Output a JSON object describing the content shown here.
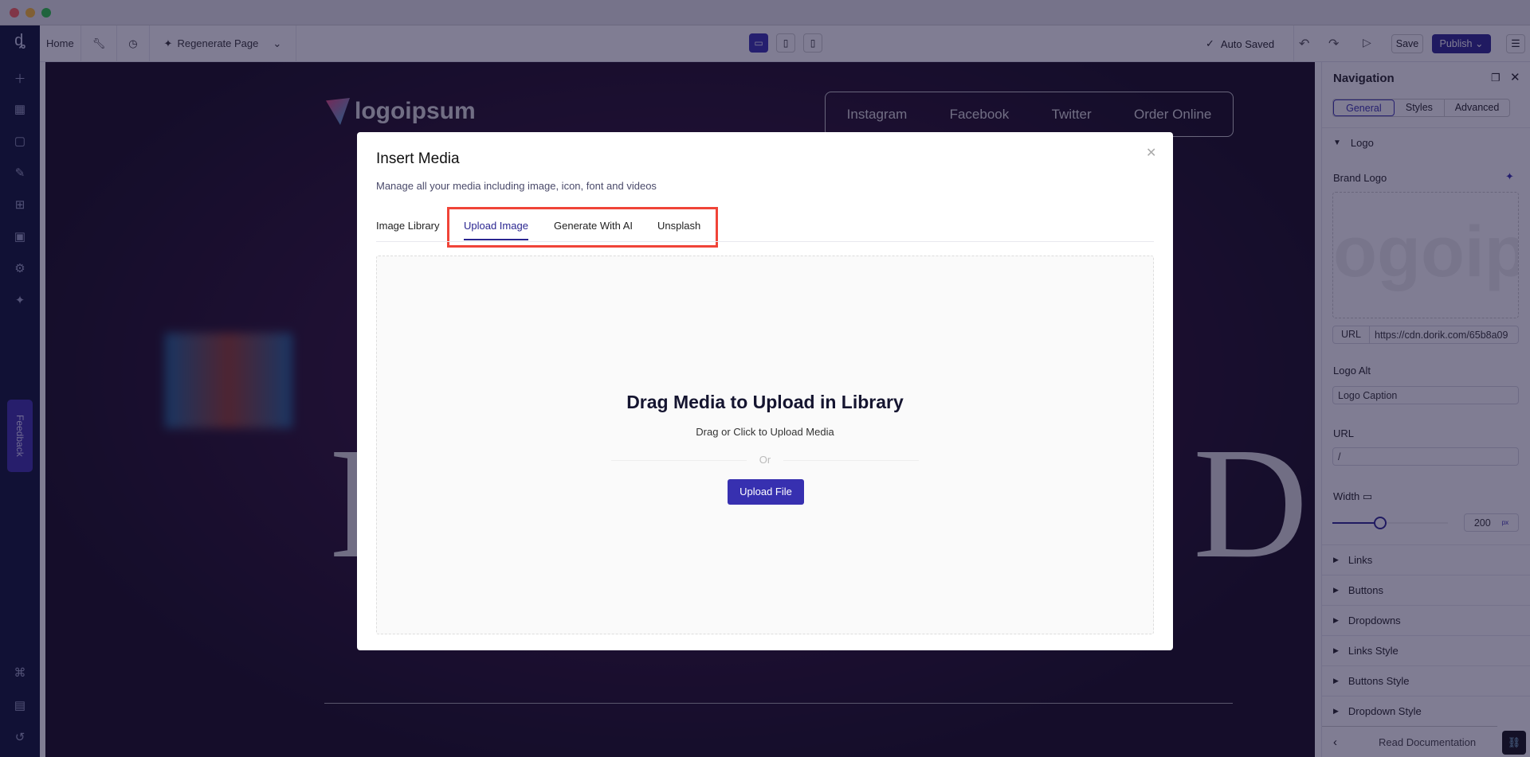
{
  "toolbar": {
    "home": "Home",
    "regenerate": "Regenerate Page",
    "auto_saved": "Auto Saved",
    "save": "Save",
    "publish": "Publish"
  },
  "sidebar": {
    "feedback": "Feedback",
    "icons": [
      "plus-icon",
      "grid-icon",
      "page-icon",
      "design-tools-icon",
      "layout-icon",
      "image-icon",
      "settings-icon",
      "ai-sparkle-icon"
    ],
    "bottom_icons": [
      "command-icon",
      "book-icon",
      "history-icon"
    ]
  },
  "canvas": {
    "logo_text": "logoipsum",
    "nav": [
      "Instagram",
      "Facebook",
      "Twitter",
      "Order Online"
    ],
    "hero_left": "I",
    "hero_right": "D"
  },
  "panel": {
    "title": "Navigation",
    "tabs": [
      "General",
      "Styles",
      "Advanced"
    ],
    "active_tab": "General",
    "logo_section": "Logo",
    "brand_logo": "Brand Logo",
    "url_label": "URL",
    "url_value": "https://cdn.dorik.com/65b8a09",
    "logo_alt_label": "Logo Alt",
    "logo_alt_value": "Logo Caption",
    "link_url_label": "URL",
    "link_url_value": "/",
    "width_label": "Width",
    "width_value": "200",
    "width_unit": "px",
    "width_slider_percent": 40,
    "sections": [
      "Links",
      "Buttons",
      "Dropdowns",
      "Links Style",
      "Buttons Style",
      "Dropdown Style"
    ],
    "footer": "Read Documentation"
  },
  "modal": {
    "title": "Insert Media",
    "subtitle": "Manage all your media including image, icon, font and videos",
    "tabs": [
      "Image Library",
      "Upload Image",
      "Generate With AI",
      "Unsplash"
    ],
    "active_tab": "Upload Image",
    "drop_title": "Drag Media to Upload in Library",
    "drop_sub": "Drag or Click to Upload Media",
    "or": "Or",
    "upload_button": "Upload File"
  },
  "colors": {
    "accent": "#3730b0",
    "highlight": "#f04438",
    "sidebar": "#0b1030"
  }
}
